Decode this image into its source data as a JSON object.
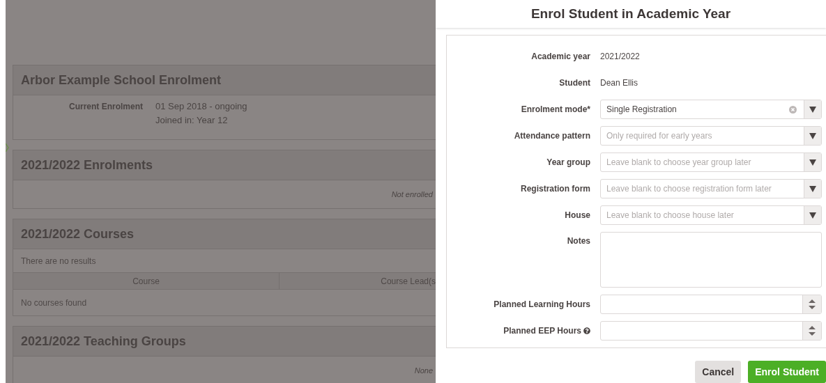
{
  "background_page": {
    "sections": [
      {
        "kind": "details",
        "title": "Arbor Example School Enrolment",
        "label": "Current Enrolment",
        "lines": [
          "01 Sep 2018 - ongoing",
          "Joined in: Year 12"
        ]
      },
      {
        "kind": "note",
        "title": "2021/2022 Enrolments",
        "note": "Not enrolled"
      },
      {
        "kind": "table",
        "title": "2021/2022 Courses",
        "message": "There are no results",
        "columns": [
          "Course",
          "Course Lead(s"
        ],
        "empty": "No courses found"
      },
      {
        "kind": "note",
        "title": "2021/2022 Teaching Groups",
        "note": "None"
      }
    ]
  },
  "dialog": {
    "title": "Enrol Student in Academic Year",
    "fields": [
      {
        "kind": "static",
        "label": "Academic year",
        "value": "2021/2022"
      },
      {
        "kind": "static",
        "label": "Student",
        "value": "Dean Ellis"
      },
      {
        "kind": "select",
        "label": "Enrolment mode*",
        "value": "Single Registration",
        "clearable": true
      },
      {
        "kind": "select",
        "label": "Attendance pattern",
        "placeholder": "Only required for early years",
        "clearable": false
      },
      {
        "kind": "select",
        "label": "Year group",
        "placeholder": "Leave blank to choose year group later",
        "clearable": false
      },
      {
        "kind": "select",
        "label": "Registration form",
        "placeholder": "Leave blank to choose registration form later",
        "clearable": false
      },
      {
        "kind": "select",
        "label": "House",
        "placeholder": "Leave blank to choose house later",
        "clearable": false
      },
      {
        "kind": "textarea",
        "label": "Notes"
      },
      {
        "kind": "number",
        "label": "Planned Learning Hours",
        "help": false
      },
      {
        "kind": "number",
        "label": "Planned EEP Hours",
        "help": true
      }
    ],
    "buttons": [
      {
        "label": "Cancel",
        "kind": "secondary"
      },
      {
        "label": "Enrol Student",
        "kind": "primary"
      }
    ]
  }
}
